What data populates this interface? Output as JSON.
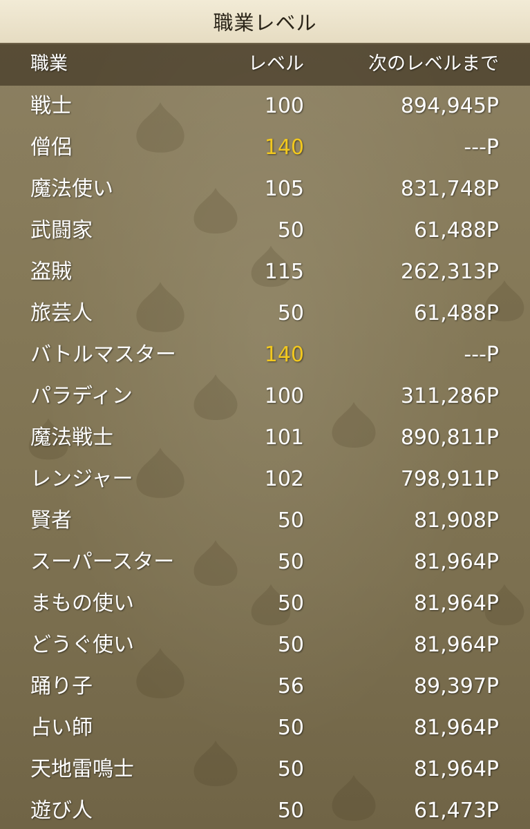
{
  "title": "職業レベル",
  "headers": {
    "job": "職業",
    "level": "レベル",
    "next": "次のレベルまで"
  },
  "colors": {
    "normal_level": "#ffffff",
    "max_level": "#f2c81e"
  },
  "rows": [
    {
      "job": "戦士",
      "level": "100",
      "next": "894,945P",
      "max": false
    },
    {
      "job": "僧侶",
      "level": "140",
      "next": "---P",
      "max": true
    },
    {
      "job": "魔法使い",
      "level": "105",
      "next": "831,748P",
      "max": false
    },
    {
      "job": "武闘家",
      "level": "50",
      "next": "61,488P",
      "max": false
    },
    {
      "job": "盗賊",
      "level": "115",
      "next": "262,313P",
      "max": false
    },
    {
      "job": "旅芸人",
      "level": "50",
      "next": "61,488P",
      "max": false
    },
    {
      "job": "バトルマスター",
      "level": "140",
      "next": "---P",
      "max": true
    },
    {
      "job": "パラディン",
      "level": "100",
      "next": "311,286P",
      "max": false
    },
    {
      "job": "魔法戦士",
      "level": "101",
      "next": "890,811P",
      "max": false
    },
    {
      "job": "レンジャー",
      "level": "102",
      "next": "798,911P",
      "max": false
    },
    {
      "job": "賢者",
      "level": "50",
      "next": "81,908P",
      "max": false
    },
    {
      "job": "スーパースター",
      "level": "50",
      "next": "81,964P",
      "max": false
    },
    {
      "job": "まもの使い",
      "level": "50",
      "next": "81,964P",
      "max": false
    },
    {
      "job": "どうぐ使い",
      "level": "50",
      "next": "81,964P",
      "max": false
    },
    {
      "job": "踊り子",
      "level": "56",
      "next": "89,397P",
      "max": false
    },
    {
      "job": "占い師",
      "level": "50",
      "next": "81,964P",
      "max": false
    },
    {
      "job": "天地雷鳴士",
      "level": "50",
      "next": "81,964P",
      "max": false
    },
    {
      "job": "遊び人",
      "level": "50",
      "next": "61,473P",
      "max": false
    }
  ]
}
